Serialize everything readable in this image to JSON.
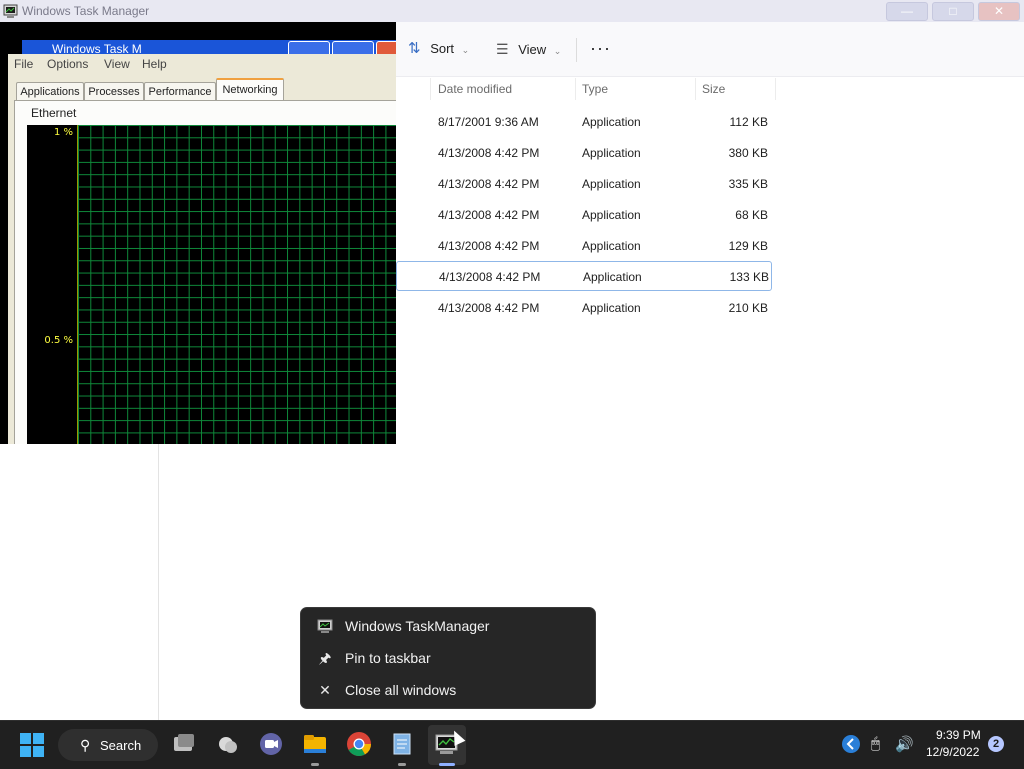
{
  "explorer": {
    "window_title": "Windows Task Manager",
    "toolbar": {
      "sort_label": "Sort",
      "view_label": "View",
      "more_label": "···"
    },
    "columns": {
      "date": "Date modified",
      "type": "Type",
      "size": "Size"
    },
    "files": [
      {
        "date": "8/17/2001 9:36 AM",
        "type": "Application",
        "size": "112 KB",
        "selected": false
      },
      {
        "date": "4/13/2008 4:42 PM",
        "type": "Application",
        "size": "380 KB",
        "selected": false
      },
      {
        "date": "4/13/2008 4:42 PM",
        "type": "Application",
        "size": "335 KB",
        "selected": false
      },
      {
        "date": "4/13/2008 4:42 PM",
        "type": "Application",
        "size": "68 KB",
        "selected": false
      },
      {
        "date": "4/13/2008 4:42 PM",
        "type": "Application",
        "size": "129 KB",
        "selected": false
      },
      {
        "date": "4/13/2008 4:42 PM",
        "type": "Application",
        "size": "133 KB",
        "selected": true
      },
      {
        "date": "4/13/2008 4:42 PM",
        "type": "Application",
        "size": "210 KB",
        "selected": false
      }
    ]
  },
  "taskmgr": {
    "ghost_title": "Windows Task M",
    "menu": [
      "File",
      "Options",
      "View",
      "Help"
    ],
    "tabs": [
      {
        "label": "Applications",
        "active": false
      },
      {
        "label": "Processes",
        "active": false
      },
      {
        "label": "Performance",
        "active": false
      },
      {
        "label": "Networking",
        "active": true
      }
    ],
    "adapter": "Ethernet",
    "y_labels": {
      "top": "1 %",
      "mid": "0.5 %"
    },
    "graph_color": "#0f8a3a",
    "label_color": "#ffff40"
  },
  "jump_list": {
    "items": [
      {
        "label": "Windows TaskManager",
        "icon": "taskmanager-icon"
      },
      {
        "label": "Pin to taskbar",
        "icon": "pin-icon"
      },
      {
        "label": "Close all windows",
        "icon": "close-icon"
      }
    ]
  },
  "taskbar": {
    "search_label": "Search",
    "apps": [
      "task-view-icon",
      "weather-icon",
      "teams-chat-icon",
      "file-explorer-icon",
      "chrome-icon",
      "notepad-icon",
      "taskmanager-icon"
    ],
    "clock_time": "9:39 PM",
    "clock_date": "12/9/2022",
    "notification_count": "2"
  }
}
